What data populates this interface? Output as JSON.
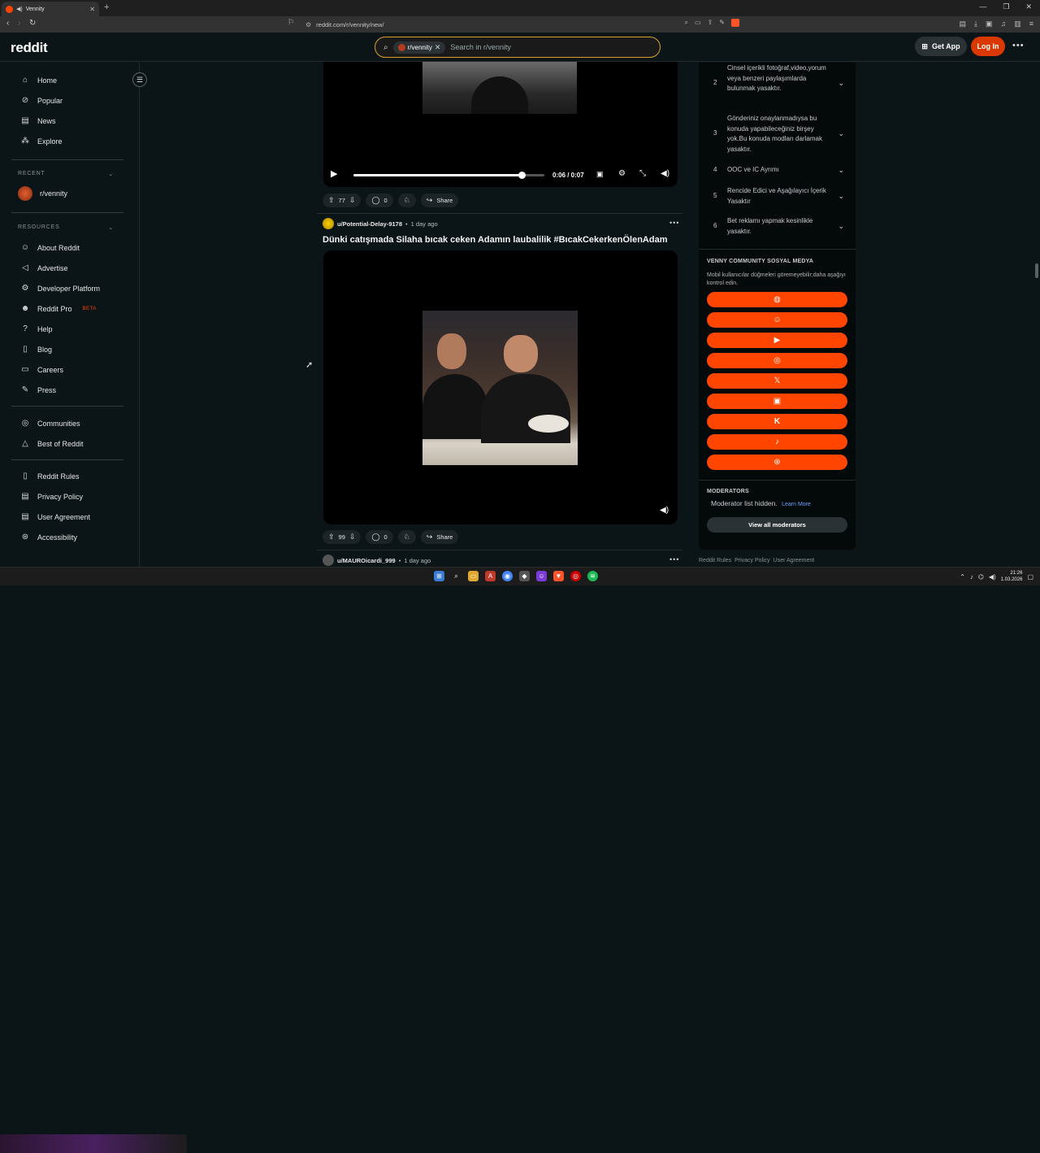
{
  "browser": {
    "tab_title": "Vennity",
    "url": "reddit.com/r/vennity/new/"
  },
  "header": {
    "logo": "reddit",
    "search_chip": "r/vennity",
    "search_placeholder": "Search in r/vennity",
    "get_app": "Get App",
    "login": "Log In"
  },
  "sidebar": {
    "nav": [
      {
        "label": "Home",
        "icon": "home-icon"
      },
      {
        "label": "Popular",
        "icon": "popular-icon"
      },
      {
        "label": "News",
        "icon": "news-icon"
      },
      {
        "label": "Explore",
        "icon": "explore-icon"
      }
    ],
    "recent_heading": "RECENT",
    "recent_item": "r/vennity",
    "resources_heading": "RESOURCES",
    "resources": [
      {
        "label": "About Reddit",
        "icon": "reddit-icon"
      },
      {
        "label": "Advertise",
        "icon": "megaphone-icon"
      },
      {
        "label": "Developer Platform",
        "icon": "gear-icon"
      },
      {
        "label": "Reddit Pro",
        "icon": "pro-icon"
      },
      {
        "label": "Help",
        "icon": "help-icon"
      },
      {
        "label": "Blog",
        "icon": "book-icon"
      },
      {
        "label": "Careers",
        "icon": "briefcase-icon"
      },
      {
        "label": "Press",
        "icon": "microphone-icon"
      }
    ],
    "reddit_pro_badge": "BETA",
    "more": [
      {
        "label": "Communities",
        "icon": "communities-icon"
      },
      {
        "label": "Best of Reddit",
        "icon": "best-icon"
      }
    ],
    "policies": [
      {
        "label": "Reddit Rules",
        "icon": "rules-icon"
      },
      {
        "label": "Privacy Policy",
        "icon": "privacy-icon"
      },
      {
        "label": "User Agreement",
        "icon": "agreement-icon"
      },
      {
        "label": "Accessibility",
        "icon": "accessibility-icon"
      }
    ]
  },
  "video_player": {
    "time": "0:06 / 0:07",
    "progress": 0.88
  },
  "posts": [
    {
      "upvotes": "77",
      "comments": "0",
      "share": "Share"
    },
    {
      "author": "u/Potential-Delay-9178",
      "age": "1 day ago",
      "title": "Dünki catışmada Silaha bıcak ceken Adamın laubalilik #BıcakCekerkenÖlenAdam",
      "upvotes": "99",
      "comments": "0",
      "share": "Share"
    },
    {
      "author": "u/MAUROicardi_999",
      "age": "1 day ago"
    }
  ],
  "rules": [
    {
      "num": "2",
      "text": "Cinsel içerikli fotoğraf,video,yorum veya benzeri paylaşımlarda bulunmak yasaktır."
    },
    {
      "num": "3",
      "text": "Gönderiniz onaylanmadıysa bu konuda yapabileceğiniz birşey yok.Bu konuda modları darlamak yasaktır."
    },
    {
      "num": "4",
      "text": "OOC ve IC Ayrımı"
    },
    {
      "num": "5",
      "text": "Rencide Edici ve Aşağılayıcı İçerik Yasaktır"
    },
    {
      "num": "6",
      "text": "Bet reklamı yapmak kesinlikle yasaktır."
    }
  ],
  "social": {
    "heading": "VENNY COMMUNITY SOSYAL MEDYA",
    "description": "Mobil kullanıcılar düğmeleri göremeyebilir;daha aşağıyı kontrol edin.",
    "buttons": [
      "globe-icon",
      "discord-icon",
      "youtube-icon",
      "instagram-icon",
      "x-icon",
      "twitch-icon",
      "kick-icon",
      "tiktok-icon",
      "steam-icon"
    ]
  },
  "moderators": {
    "heading": "MODERATORS",
    "text": "Moderator list hidden.",
    "learn_more": "Learn More",
    "view_all": "View all moderators"
  },
  "footer_links": [
    "Reddit Rules",
    "Privacy Policy",
    "User Agreement"
  ],
  "taskbar": {
    "time": "21:26",
    "date": "1.03.2026"
  },
  "colors": {
    "accent": "#ff4500",
    "login_bg": "#d93900",
    "page_bg": "#0b1416",
    "search_border": "#d4a22b"
  }
}
